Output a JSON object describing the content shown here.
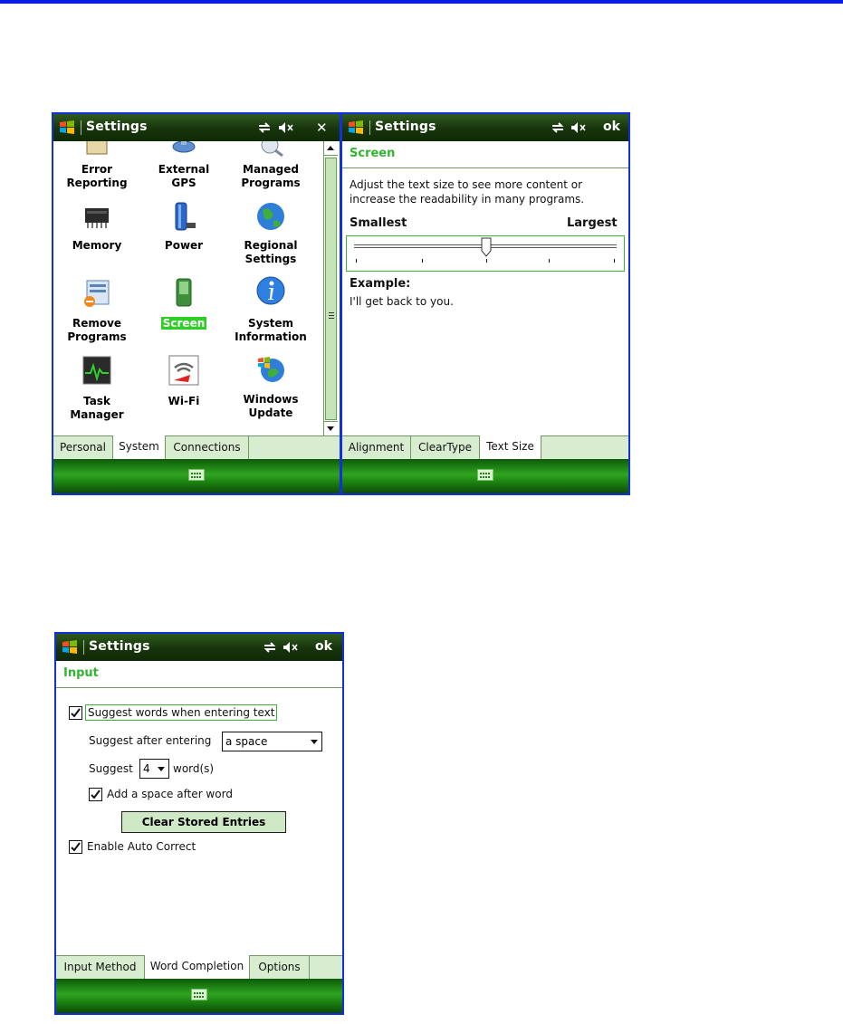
{
  "screen1": {
    "title": "Settings",
    "close": "✕",
    "items": [
      {
        "name": "error-reporting",
        "label": "Error\nReporting",
        "icon": "error-reporting-icon"
      },
      {
        "name": "external-gps",
        "label": "External\nGPS",
        "icon": "satellite-icon"
      },
      {
        "name": "managed-programs",
        "label": "Managed\nPrograms",
        "icon": "managed-programs-icon"
      },
      {
        "name": "memory",
        "label": "Memory",
        "icon": "memory-chip-icon"
      },
      {
        "name": "power",
        "label": "Power",
        "icon": "battery-icon"
      },
      {
        "name": "regional-settings",
        "label": "Regional\nSettings",
        "icon": "globe-icon"
      },
      {
        "name": "remove-programs",
        "label": "Remove\nPrograms",
        "icon": "remove-programs-icon"
      },
      {
        "name": "screen",
        "label": "Screen",
        "icon": "screen-device-icon",
        "selected": true
      },
      {
        "name": "system-information",
        "label": "System\nInformation",
        "icon": "info-icon"
      },
      {
        "name": "task-manager",
        "label": "Task\nManager",
        "icon": "task-manager-icon"
      },
      {
        "name": "wi-fi",
        "label": "Wi-Fi",
        "icon": "wifi-icon"
      },
      {
        "name": "windows-update",
        "label": "Windows\nUpdate",
        "icon": "windows-update-icon"
      }
    ],
    "tabs": [
      "Personal",
      "System",
      "Connections"
    ],
    "active_tab": "System"
  },
  "screen2": {
    "title": "Settings",
    "ok": "ok",
    "heading": "Screen",
    "description": "Adjust the text size to see more content or increase the readability in many programs.",
    "slider_min_label": "Smallest",
    "slider_max_label": "Largest",
    "slider_position": "3 of 5",
    "example_label": "Example:",
    "example_text": "I'll get back to you.",
    "tabs": [
      "Alignment",
      "ClearType",
      "Text Size"
    ],
    "active_tab": "Text Size"
  },
  "screen3": {
    "title": "Settings",
    "ok": "ok",
    "heading": "Input",
    "suggest_words_label": "Suggest words when entering text",
    "suggest_words_checked": true,
    "suggest_after_label": "Suggest after entering",
    "suggest_after_value": "a space",
    "suggest_label": "Suggest",
    "suggest_count_value": "4",
    "words_label": "word(s)",
    "add_space_label": "Add a space after word",
    "add_space_checked": true,
    "clear_button": "Clear Stored Entries",
    "auto_correct_label": "Enable Auto Correct",
    "auto_correct_checked": true,
    "tabs": [
      "Input Method",
      "Word Completion",
      "Options"
    ],
    "active_tab": "Word Completion"
  },
  "colors": {
    "frame": "#1330e0",
    "titlebar": "#17340c",
    "accent_green": "#31b531",
    "tab_bg": "#d8ecd0"
  }
}
